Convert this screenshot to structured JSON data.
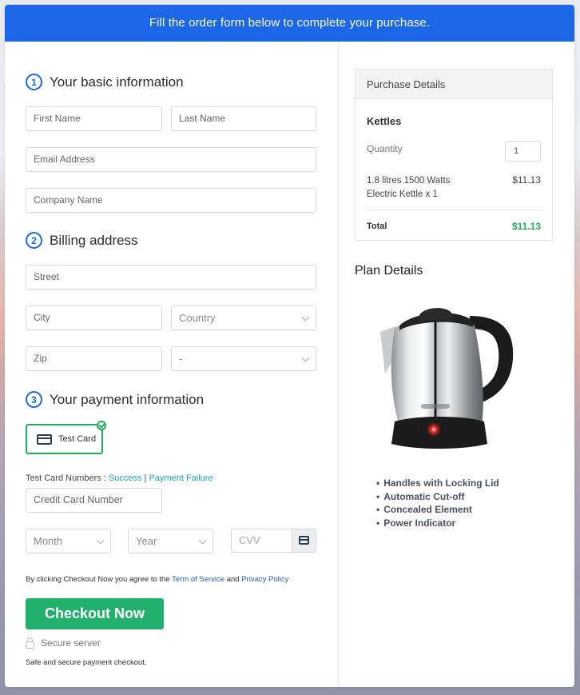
{
  "banner": {
    "text": "Fill the order form below to complete your purchase."
  },
  "form": {
    "sections": [
      {
        "number": "1",
        "title": "Your basic information"
      },
      {
        "number": "2",
        "title": "Billing address"
      },
      {
        "number": "3",
        "title": "Your payment information"
      }
    ],
    "basic": {
      "first_name": {
        "placeholder": "First Name",
        "value": ""
      },
      "last_name": {
        "placeholder": "Last Name",
        "value": ""
      },
      "email": {
        "placeholder": "Email Address",
        "value": ""
      },
      "company": {
        "placeholder": "Company Name",
        "value": ""
      }
    },
    "billing": {
      "street": {
        "placeholder": "Street",
        "value": ""
      },
      "city": {
        "placeholder": "City",
        "value": ""
      },
      "country": {
        "selected": "Country"
      },
      "zip": {
        "placeholder": "Zip",
        "value": ""
      },
      "state": {
        "selected": "-"
      }
    },
    "payment": {
      "method_label": "Test Card",
      "method_selected": true,
      "test_card_prefix": "Test Card Numbers : ",
      "success_link": "Success",
      "separator": " | ",
      "failure_link": "Payment Failure",
      "card_number": {
        "placeholder": "Credit Card Number",
        "value": ""
      },
      "month": {
        "selected": "Month"
      },
      "year": {
        "selected": "Year"
      },
      "cvv": {
        "placeholder": "CVV",
        "value": ""
      }
    },
    "agreement": {
      "prefix": "By clicking Checkout Now you agree to the ",
      "terms_link": "Term of Service",
      "middle": " and ",
      "privacy_link": "Privacy Policy"
    },
    "checkout_label": "Checkout Now",
    "secure_label": "Secure server",
    "safe_text": "Safe and secure payment checkout."
  },
  "purchase": {
    "header": "Purchase Details",
    "product_title": "Kettles",
    "quantity_label": "Quantity",
    "quantity": "1",
    "item_description": "1.8 litres 1500 Watts Electric Kettle x 1",
    "item_price": "$11.13",
    "total_label": "Total",
    "total": "$11.13"
  },
  "plan": {
    "title": "Plan Details",
    "image_alt": "Stainless steel electric kettle",
    "features": [
      "Handles with Locking Lid",
      "Automatic Cut-off",
      "Concealed Element",
      "Power Indicator"
    ]
  },
  "colors": {
    "banner": "#1b67e8",
    "accent_green": "#21b16c",
    "total_green": "#22ad5c",
    "link_teal": "#1fa3bd",
    "link_blue": "#1b67b8"
  }
}
